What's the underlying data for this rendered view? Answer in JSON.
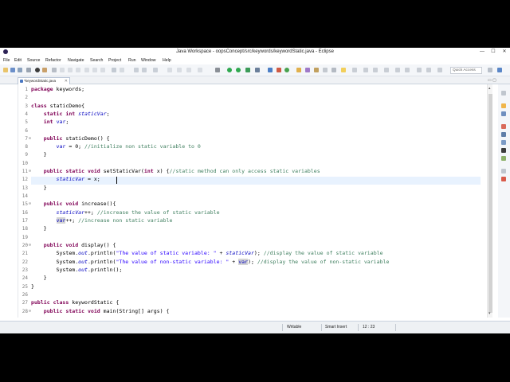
{
  "window": {
    "title": "Java Workspace - oopsConcept/src/keywords/keywordStatic.java - Eclipse",
    "minimize": "—",
    "maximize": "☐",
    "close": "✕"
  },
  "menu": [
    "File",
    "Edit",
    "Source",
    "Refactor",
    "Navigate",
    "Search",
    "Project",
    "Run",
    "Window",
    "Help"
  ],
  "toolbar": {
    "quick_access_placeholder": "Quick Access"
  },
  "editor": {
    "tab_label": "*keywordStatic.java",
    "tab_close": "✕",
    "tab_minmax": "▭ ▢",
    "line_numbers": [
      "1",
      "2",
      "3",
      "4",
      "5",
      "6",
      "7",
      "8",
      "9",
      "10",
      "11",
      "12",
      "13",
      "14",
      "15",
      "16",
      "17",
      "18",
      "19",
      "20",
      "21",
      "22",
      "23",
      "24",
      "25",
      "26",
      "27",
      "28"
    ],
    "code": {
      "l1_a": "package",
      "l1_b": " keywords;",
      "l3_a": "class",
      "l3_b": " staticDemo{",
      "l4_a": "static int",
      "l4_b": "staticVar",
      "l4_c": ";",
      "l5_a": "int",
      "l5_b": "var",
      "l5_c": ";",
      "l7_a": "public",
      "l7_b": " staticDemo() {",
      "l8_a": "var",
      "l8_b": " = 0; ",
      "l8_c": "//initialize non static variable to 0",
      "l9": "}",
      "l11_a": "public static void",
      "l11_b": " setStaticVar(",
      "l11_c": "int",
      "l11_d": " x) {",
      "l11_e": "//static method can only access static variables",
      "l12_a": "staticVar",
      "l12_b": " = x;",
      "l13": "}",
      "l15_a": "public void",
      "l15_b": " increase(){",
      "l16_a": "staticVar",
      "l16_b": "++; ",
      "l16_c": "//increase the value of static variable",
      "l17_a": "var",
      "l17_b": "++; ",
      "l17_c": "//increase non static variable",
      "l18": "}",
      "l20_a": "public void",
      "l20_b": " display() {",
      "l21_a": "System.",
      "l21_b": "out",
      "l21_c": ".println(",
      "l21_d": "\"The value of static variable: \"",
      "l21_e": " + ",
      "l21_f": "staticVar",
      "l21_g": "); ",
      "l21_h": "//display the value of static variable",
      "l22_a": "System.",
      "l22_b": "out",
      "l22_c": ".println(",
      "l22_d": "\"The value of non-static variable: \"",
      "l22_e": " + ",
      "l22_f": "var",
      "l22_g": "); ",
      "l22_h": "//display the value of non-static variable",
      "l23_a": "System.",
      "l23_b": "out",
      "l23_c": ".println();",
      "l24": "}",
      "l25": "}",
      "l27_a": "public class",
      "l27_b": " keywordStatic {",
      "l28_a": "public static void",
      "l28_b": " main(String[] args) {"
    }
  },
  "status": {
    "writable": "Writable",
    "insert_mode": "Smart Insert",
    "position": "12 : 23"
  },
  "colors": {
    "keyword": "#7f0055",
    "field": "#0000c0",
    "comment": "#3f7f5f",
    "string": "#2a00ff",
    "current_line": "#e8f2fe"
  }
}
